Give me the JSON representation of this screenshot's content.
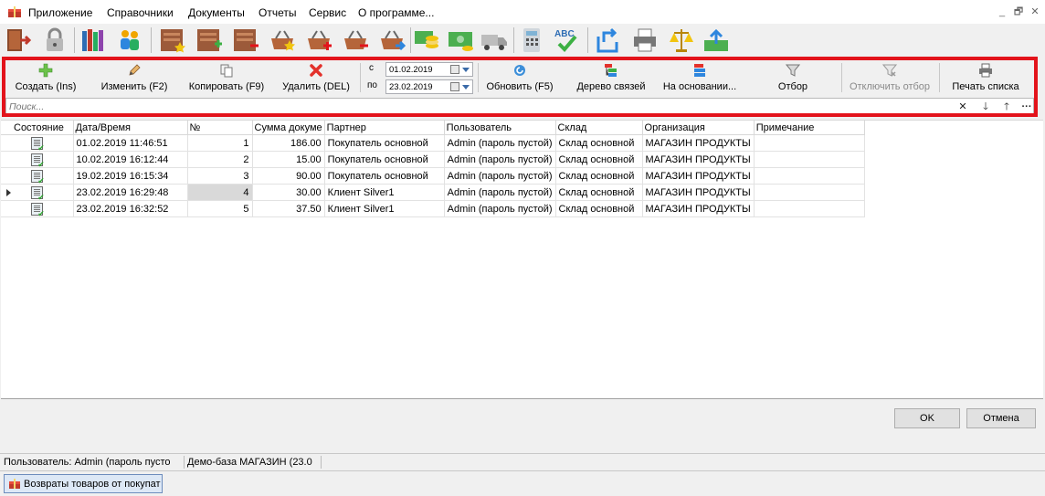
{
  "menu": {
    "items": [
      "Приложение",
      "Справочники",
      "Документы",
      "Отчеты",
      "Сервис",
      "О программе..."
    ]
  },
  "window_controls": {
    "minimize": "_",
    "restore": "🗗",
    "close": "✕"
  },
  "actions": {
    "create": "Создать (Ins)",
    "edit": "Изменить (F2)",
    "copy": "Копировать (F9)",
    "delete": "Удалить (DEL)",
    "refresh": "Обновить (F5)",
    "tree": "Дерево связей",
    "based_on": "На основании...",
    "filter": "Отбор",
    "disable_filter": "Отключить отбор",
    "print": "Печать списка"
  },
  "period": {
    "from_label": "с",
    "to_label": "по",
    "from_value": "01.02.2019",
    "to_value": "23.02.2019"
  },
  "search": {
    "placeholder": "Поиск..."
  },
  "table": {
    "columns": [
      "Состояние",
      "Дата/Время",
      "№",
      "Сумма докуме",
      "Партнер",
      "Пользователь",
      "Склад",
      "Организация",
      "Примечание"
    ],
    "rows": [
      {
        "datetime": "01.02.2019 11:46:51",
        "num": "1",
        "sum": "186.00",
        "partner": "Покупатель основной",
        "user": "Admin (пароль пустой)",
        "warehouse": "Склад основной",
        "org": "МАГАЗИН ПРОДУКТЫ",
        "note": ""
      },
      {
        "datetime": "10.02.2019 16:12:44",
        "num": "2",
        "sum": "15.00",
        "partner": "Покупатель основной",
        "user": "Admin (пароль пустой)",
        "warehouse": "Склад основной",
        "org": "МАГАЗИН ПРОДУКТЫ",
        "note": ""
      },
      {
        "datetime": "19.02.2019 16:15:34",
        "num": "3",
        "sum": "90.00",
        "partner": "Покупатель основной",
        "user": "Admin (пароль пустой)",
        "warehouse": "Склад основной",
        "org": "МАГАЗИН ПРОДУКТЫ",
        "note": ""
      },
      {
        "datetime": "23.02.2019 16:29:48",
        "num": "4",
        "sum": "30.00",
        "partner": "Клиент Silver1",
        "user": "Admin (пароль пустой)",
        "warehouse": "Склад основной",
        "org": "МАГАЗИН ПРОДУКТЫ",
        "note": ""
      },
      {
        "datetime": "23.02.2019 16:32:52",
        "num": "5",
        "sum": "37.50",
        "partner": "Клиент Silver1",
        "user": "Admin (пароль пустой)",
        "warehouse": "Склад основной",
        "org": "МАГАЗИН ПРОДУКТЫ",
        "note": ""
      }
    ]
  },
  "dialog": {
    "ok": "OK",
    "cancel": "Отмена"
  },
  "status": {
    "user": "Пользователь: Admin (пароль пусто",
    "db": "Демо-база МАГАЗИН (23.0"
  },
  "taskbar": {
    "tab": "Возвраты товаров от покупат"
  },
  "colors": {
    "highlight_frame": "#e3131b",
    "selected_cell": "#d9d9d9"
  },
  "toolbar_icons": [
    "exit-door-icon",
    "lock-icon",
    "books-icon",
    "users-icon",
    "doc-star-icon",
    "doc-add-icon",
    "doc-remove-icon",
    "basket-star-icon",
    "basket-add-icon",
    "basket-remove-icon",
    "basket-move-icon",
    "coins-icon",
    "money-icon",
    "truck-icon",
    "calculator-icon",
    "spellcheck-icon",
    "export-icon",
    "printer-icon",
    "scales-icon",
    "upload-icon"
  ]
}
